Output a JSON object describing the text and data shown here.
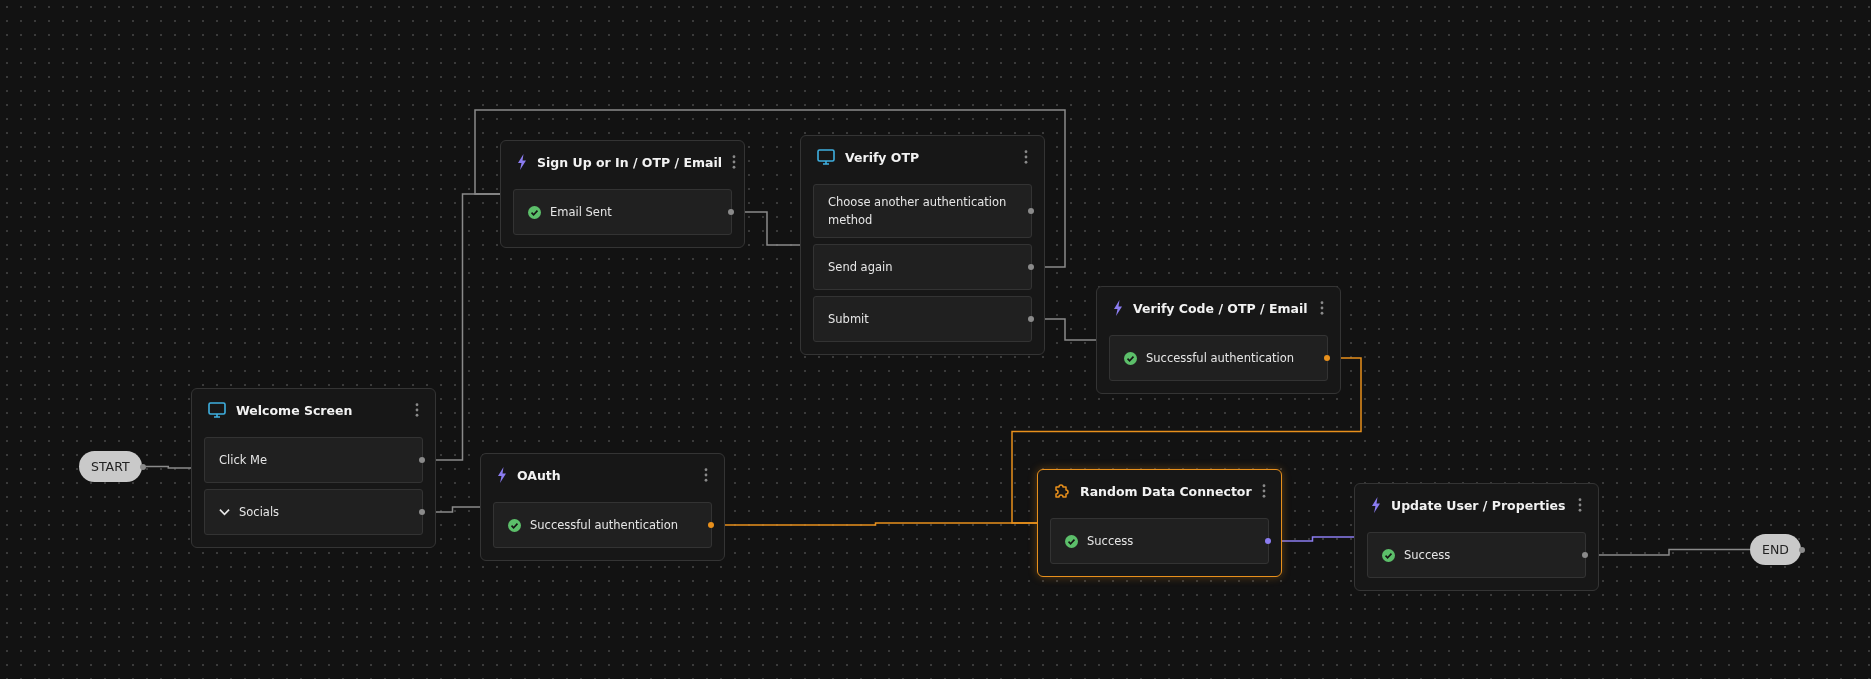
{
  "nodes": [
    {
      "kind": "terminal",
      "title": "START",
      "selected": false
    },
    {
      "kind": "screen",
      "title": "Welcome Screen",
      "selected": false,
      "rows": [
        {
          "kind": "button",
          "label": "Click Me"
        },
        {
          "kind": "group",
          "label": "Socials",
          "expanded": false
        }
      ]
    },
    {
      "kind": "action",
      "title": "Sign Up or In / OTP / Email",
      "selected": false,
      "rows": [
        {
          "kind": "outcome",
          "label": "Email Sent"
        }
      ]
    },
    {
      "kind": "screen",
      "title": "Verify OTP",
      "selected": false,
      "rows": [
        {
          "kind": "button",
          "label": "Choose another authentication method"
        },
        {
          "kind": "button",
          "label": "Send again"
        },
        {
          "kind": "button",
          "label": "Submit"
        }
      ]
    },
    {
      "kind": "action",
      "title": "Verify Code / OTP / Email",
      "selected": false,
      "rows": [
        {
          "kind": "outcome",
          "label": "Successful authentication"
        }
      ]
    },
    {
      "kind": "action",
      "title": "OAuth",
      "selected": false,
      "rows": [
        {
          "kind": "outcome",
          "label": "Successful authentication"
        }
      ]
    },
    {
      "kind": "connector",
      "title": "Random Data Connector",
      "selected": true,
      "rows": [
        {
          "kind": "outcome",
          "label": "Success"
        }
      ]
    },
    {
      "kind": "action",
      "title": "Update User / Properties",
      "selected": false,
      "rows": [
        {
          "kind": "outcome",
          "label": "Success"
        }
      ]
    },
    {
      "kind": "terminal",
      "title": "END",
      "selected": false
    }
  ]
}
